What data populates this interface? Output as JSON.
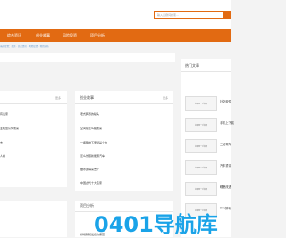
{
  "search": {
    "placeholder": "输入关键词搜索..."
  },
  "nav": [
    "综合资讯",
    "创业故事",
    "风险投资",
    "项目分析"
  ],
  "breadcrumb": "当前位置：首页 · 综合资讯 · 风险投资 · 项目分析",
  "left_card1": {
    "items": [
      "",
      "有几家",
      "业机会从何而来",
      "",
      "支",
      "",
      "人看"
    ]
  },
  "left_card2": {
    "items": [
      "",
      "",
      "",
      "",
      ""
    ]
  },
  "middle_card1": {
    "title": "创业故事",
    "more": "更多",
    "items": [
      "老式胸罩的秘头",
      "空间站怎么拖而来",
      "一瓶帮地下里就是个坑",
      "怎么仿照新能源汽车",
      "做水贵得来去个",
      "中国古代十大名家"
    ]
  },
  "middle_card2": {
    "title": "项目分析",
    "more": "更多",
    "items": [
      "好端就就发表的痛苦"
    ]
  },
  "left_more": "更多",
  "sidebar": {
    "title": "热门文章",
    "items": [
      {
        "thumb": "好职网一手资源",
        "title": "社交软件"
      },
      {
        "thumb": "好职网一手资源",
        "title": "手机上下载"
      },
      {
        "thumb": "好职网一手资源",
        "title": "二轮電车"
      },
      {
        "thumb": "好职网一手资源",
        "title": "汽车重评"
      },
      {
        "thumb": "好职网一手资源",
        "title": "睡眠改进"
      },
      {
        "thumb": "好职网一手资源",
        "title": "T11拼利"
      }
    ]
  },
  "watermark": "0401导航库"
}
